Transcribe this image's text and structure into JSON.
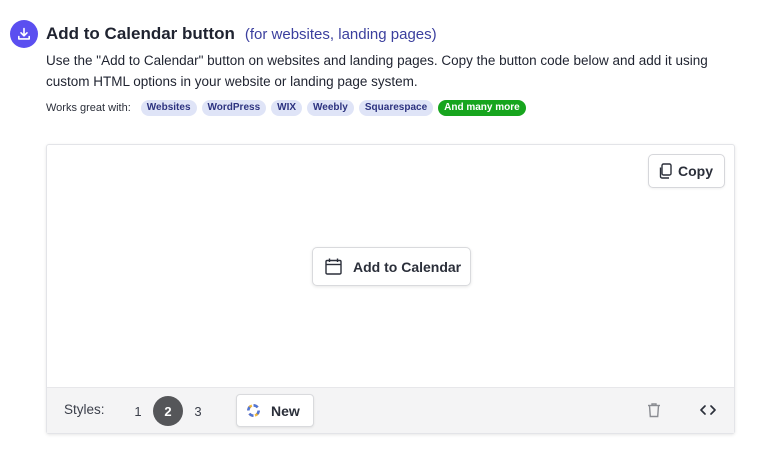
{
  "header": {
    "icon": "download-icon",
    "title": "Add to Calendar button",
    "subtitle": "(for websites, landing pages)",
    "description": "Use the \"Add to Calendar\" button on websites and landing pages. Copy the button code below and add it using custom HTML options in your website or landing page system.",
    "accent_color": "#5b4ff0"
  },
  "works_with": {
    "label": "Works great with:",
    "chips": [
      "Websites",
      "WordPress",
      "WIX",
      "Weebly",
      "Squarespace"
    ],
    "more_chip": "And many more"
  },
  "preview": {
    "copy_button": "Copy",
    "copy_icon": "copy-icon",
    "add_to_calendar_button": "Add to Calendar",
    "calendar_icon": "calendar-icon"
  },
  "footer": {
    "styles_label": "Styles:",
    "style_options": [
      "1",
      "2",
      "3"
    ],
    "selected_style": "2",
    "new_button": "New",
    "new_icon": "color-wheel-icon",
    "trash_icon": "trash-icon",
    "code_icon": "code-icon"
  }
}
